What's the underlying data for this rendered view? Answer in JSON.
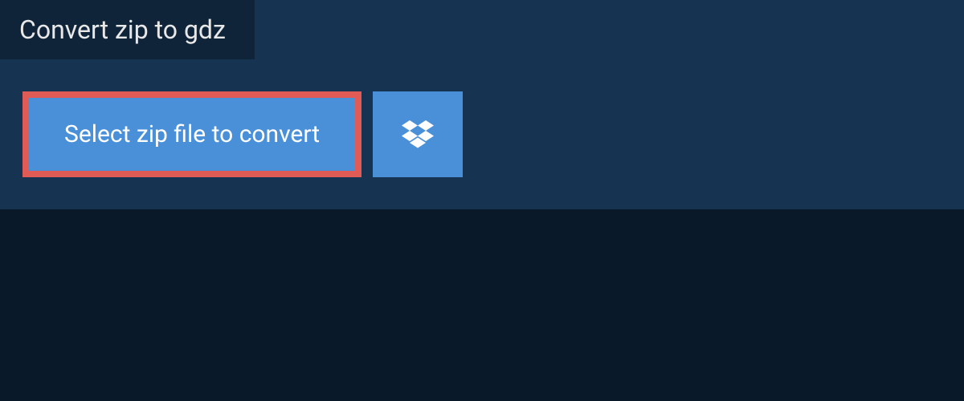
{
  "tab": {
    "title": "Convert zip to gdz"
  },
  "buttons": {
    "select_label": "Select zip file to convert",
    "dropbox_aria": "Dropbox"
  },
  "colors": {
    "page_bg": "#0a1929",
    "panel_bg": "#163452",
    "tab_bg": "#0f2438",
    "button_bg": "#4a90d9",
    "highlight_border": "#e15b56",
    "text_light": "#e8e8e8",
    "text_white": "#ffffff"
  }
}
